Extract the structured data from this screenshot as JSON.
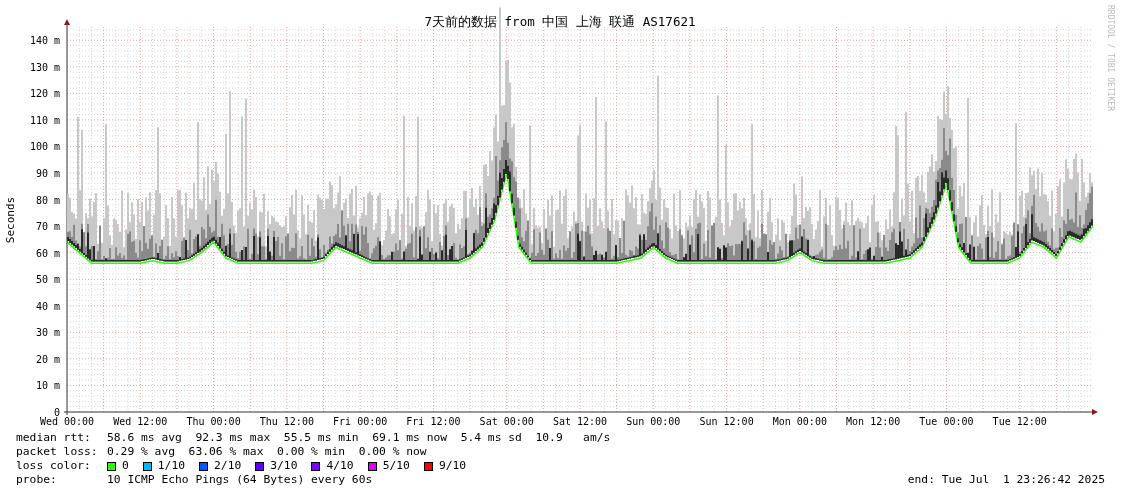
{
  "graph": {
    "watermark": "RRDTOOL / TOBI OETIKER",
    "chart_data": {
      "type": "line",
      "title": "7天前的数据 from 中国 上海 联通 AS17621",
      "ylabel": "Seconds",
      "ylim": [
        0,
        145
      ],
      "grid": true,
      "yticks": [
        {
          "value": 0,
          "label": "0"
        },
        {
          "value": 10,
          "label": "10 m"
        },
        {
          "value": 20,
          "label": "20 m"
        },
        {
          "value": 30,
          "label": "30 m"
        },
        {
          "value": 40,
          "label": "40 m"
        },
        {
          "value": 50,
          "label": "50 m"
        },
        {
          "value": 60,
          "label": "60 m"
        },
        {
          "value": 70,
          "label": "70 m"
        },
        {
          "value": 80,
          "label": "80 m"
        },
        {
          "value": 90,
          "label": "90 m"
        },
        {
          "value": 100,
          "label": "100 m"
        },
        {
          "value": 110,
          "label": "110 m"
        },
        {
          "value": 120,
          "label": "120 m"
        },
        {
          "value": 130,
          "label": "130 m"
        },
        {
          "value": 140,
          "label": "140 m"
        }
      ],
      "categories": [
        "Wed 00:00",
        null,
        null,
        null,
        null,
        null,
        "Wed 12:00",
        null,
        null,
        null,
        null,
        null,
        "Thu 00:00",
        null,
        null,
        null,
        null,
        null,
        "Thu 12:00",
        null,
        null,
        null,
        null,
        null,
        "Fri 00:00",
        null,
        null,
        null,
        null,
        null,
        "Fri 12:00",
        null,
        null,
        null,
        null,
        null,
        "Sat 00:00",
        null,
        null,
        null,
        null,
        null,
        "Sat 12:00",
        null,
        null,
        null,
        null,
        null,
        "Sun 00:00",
        null,
        null,
        null,
        null,
        null,
        "Sun 12:00",
        null,
        null,
        null,
        null,
        null,
        "Mon 00:00",
        null,
        null,
        null,
        null,
        null,
        "Mon 12:00",
        null,
        null,
        null,
        null,
        null,
        "Tue 00:00",
        null,
        null,
        null,
        null,
        null,
        "Tue 12:00",
        null,
        null,
        null,
        null,
        null,
        null
      ],
      "series": [
        {
          "color": "#26ff00",
          "values": [
            64,
            60,
            56,
            56,
            56,
            56,
            56,
            57,
            56,
            56,
            57,
            60,
            64,
            58,
            56,
            56,
            56,
            56,
            56,
            56,
            56,
            57,
            62,
            60,
            58,
            56,
            56,
            56,
            56,
            56,
            56,
            56,
            56,
            58,
            62,
            72,
            90,
            62,
            56,
            56,
            56,
            56,
            56,
            56,
            56,
            56,
            57,
            58,
            62,
            58,
            56,
            56,
            56,
            56,
            56,
            56,
            56,
            56,
            56,
            57,
            60,
            57,
            56,
            56,
            56,
            56,
            56,
            56,
            57,
            58,
            62,
            72,
            86,
            62,
            56,
            56,
            56,
            56,
            58,
            64,
            62,
            58,
            66,
            64,
            70
          ]
        }
      ]
    }
  },
  "legend": {
    "median_rtt": {
      "label": "median rtt:",
      "text": "58.6 ms avg  92.3 ms max  55.5 ms min  69.1 ms now  5.4 ms sd  10.9   am/s"
    },
    "packet_loss": {
      "label": "packet loss:",
      "text": "0.29 % avg  63.06 % max  0.00 % min  0.00 % now"
    },
    "loss_color": {
      "label": "loss color:",
      "items": [
        {
          "label": "0",
          "color": "#26ff00"
        },
        {
          "label": "1/10",
          "color": "#00b8ff"
        },
        {
          "label": "2/10",
          "color": "#0059ff"
        },
        {
          "label": "3/10",
          "color": "#5e00ff"
        },
        {
          "label": "4/10",
          "color": "#7e00ff"
        },
        {
          "label": "5/10",
          "color": "#dd00ff"
        },
        {
          "label": "9/10",
          "color": "#ff0000"
        }
      ]
    },
    "probe": {
      "label": "probe:",
      "text": "10 ICMP Echo Pings (64 Bytes) every 60s"
    },
    "end": "end: Tue Jul  1 23:26:42 2025"
  }
}
